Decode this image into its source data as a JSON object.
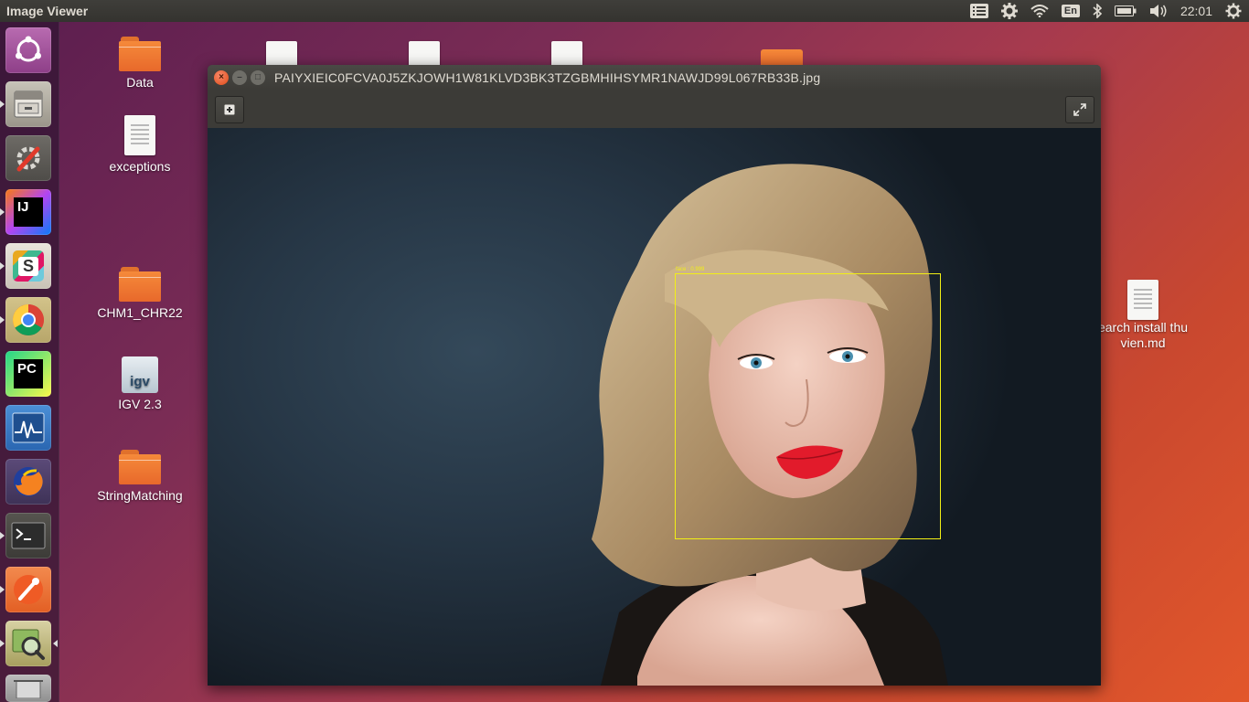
{
  "top_panel": {
    "app_title": "Image Viewer",
    "language": "En",
    "time": "22:01",
    "indicators": [
      "menu-icon",
      "settings-icon",
      "wifi-icon",
      "language-icon",
      "bluetooth-icon",
      "battery-icon",
      "volume-icon",
      "clock",
      "power-icon"
    ]
  },
  "launcher": {
    "items": [
      "ubuntu-dash",
      "files",
      "system-settings",
      "intellij-idea",
      "slack",
      "chrome",
      "pycharm",
      "system-monitor",
      "firefox",
      "terminal",
      "postman",
      "image-viewer",
      "trash"
    ]
  },
  "desktop": {
    "icons": [
      {
        "label": "Data",
        "type": "folder"
      },
      {
        "label": "exceptions",
        "type": "document"
      },
      {
        "label": "CHM1_CHR22",
        "type": "folder"
      },
      {
        "label": "IGV 2.3",
        "type": "app",
        "badge": "igv"
      },
      {
        "label": "StringMatching",
        "type": "folder"
      },
      {
        "label": "earch install thu vien.md",
        "type": "document"
      }
    ]
  },
  "window": {
    "title": "PAIYXIEIC0FCVA0J5ZKJOWH1W81KLVD3BK3TZGBMHIHSYMR1NAWJD99L067RB33B.jpg",
    "toolbar": {
      "add_icon": "plus-icon",
      "fullscreen_icon": "fullscreen-icon"
    },
    "detection": {
      "label": "face : 0.999",
      "color": "#f2ef15"
    }
  }
}
